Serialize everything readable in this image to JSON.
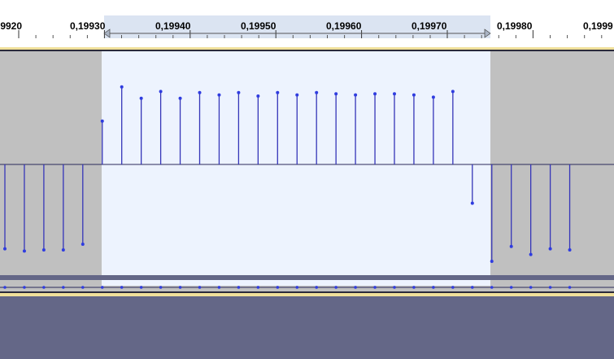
{
  "timeline": {
    "tick_labels": [
      ",9920",
      "0,19930",
      "0,19940",
      "0,19950",
      "0,19960",
      "0,19970",
      "0,19980",
      "0,1999"
    ]
  },
  "colors": {
    "background_unselected": "#c0c0c0",
    "background_selected": "#edf3fe",
    "selection_ruler": "#dbe4f2",
    "stem": "#3535b8",
    "dot": "#2f3ce0",
    "baseline": "#2a2a5a",
    "track_border_yellow": "#f0e09a",
    "bottom_area": "#646787"
  },
  "waveform": {
    "sample_values": [
      -0.74,
      -0.76,
      -0.75,
      -0.75,
      -0.7,
      0.38,
      0.68,
      0.58,
      0.64,
      0.58,
      0.63,
      0.61,
      0.63,
      0.6,
      0.63,
      0.61,
      0.63,
      0.62,
      0.61,
      0.62,
      0.62,
      0.61,
      0.59,
      0.64,
      -0.34,
      -0.85,
      -0.72,
      -0.79,
      -0.74,
      -0.75
    ]
  }
}
